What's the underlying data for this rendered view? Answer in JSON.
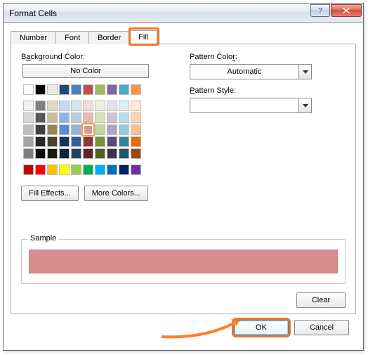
{
  "window": {
    "title": "Format Cells"
  },
  "tabs": {
    "number": "Number",
    "font": "Font",
    "border": "Border",
    "fill": "Fill",
    "active": "Fill"
  },
  "left": {
    "bg_label_pre": "B",
    "bg_label_ul": "a",
    "bg_label_post": "ckground Color:",
    "no_color": "No Color",
    "effects_btn": "Fill Effects...",
    "more_btn": "More Colors..."
  },
  "right": {
    "pat_color_pre": "Pattern Colo",
    "pat_color_ul": "r",
    "pat_color_post": ":",
    "pat_color_value": "Automatic",
    "pat_style_pre": "",
    "pat_style_ul": "P",
    "pat_style_post": "attern Style:",
    "pat_style_value": ""
  },
  "sample": {
    "label": "Sample",
    "color": "#d68e8e"
  },
  "clear": "Clear",
  "footer": {
    "ok": "OK",
    "cancel": "Cancel"
  },
  "colors": {
    "row_top": [
      "#ffffff",
      "#000000",
      "#eeece1",
      "#1f497d",
      "#4f81bd",
      "#c0504d",
      "#9bbb59",
      "#8064a2",
      "#4bacc6",
      "#f79646"
    ],
    "grid": [
      [
        "#f2f2f2",
        "#7f7f7f",
        "#ddd9c3",
        "#c6d9f0",
        "#dbe5f1",
        "#f2dcdb",
        "#ebf1dd",
        "#e5e0ec",
        "#dbeef3",
        "#fdeada"
      ],
      [
        "#d8d8d8",
        "#595959",
        "#c4bd97",
        "#8db3e2",
        "#b8cce4",
        "#e5b9b7",
        "#d7e3bc",
        "#ccc1d9",
        "#b7dde8",
        "#fbd5b5"
      ],
      [
        "#bfbfbf",
        "#3f3f3f",
        "#938953",
        "#548dd4",
        "#95b3d7",
        "#d99694",
        "#c3d69b",
        "#b2a2c7",
        "#92cddc",
        "#fac08f"
      ],
      [
        "#a5a5a5",
        "#262626",
        "#494429",
        "#17365d",
        "#366092",
        "#953734",
        "#76923c",
        "#5f497a",
        "#31859b",
        "#e36c09"
      ],
      [
        "#7f7f7f",
        "#0c0c0c",
        "#1d1b10",
        "#0f243e",
        "#244061",
        "#632423",
        "#4f6128",
        "#3f3151",
        "#205867",
        "#974806"
      ]
    ],
    "standard": [
      "#c00000",
      "#ff0000",
      "#ffc000",
      "#ffff00",
      "#92d050",
      "#00b050",
      "#00b0f0",
      "#0070c0",
      "#002060",
      "#7030a0"
    ],
    "selected": {
      "row": 2,
      "col": 5
    }
  }
}
